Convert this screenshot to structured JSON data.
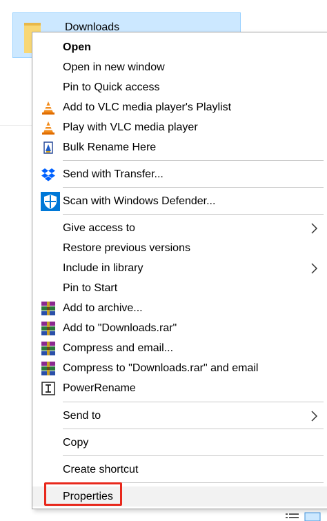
{
  "folder": {
    "label": "Downloads"
  },
  "menu": {
    "items": [
      {
        "label": "Open",
        "bold": true,
        "icon": ""
      },
      {
        "label": "Open in new window",
        "icon": ""
      },
      {
        "label": "Pin to Quick access",
        "icon": ""
      },
      {
        "label": "Add to VLC media player's Playlist",
        "icon": "vlc-cone-icon"
      },
      {
        "label": "Play with VLC media player",
        "icon": "vlc-cone-icon"
      },
      {
        "label": "Bulk Rename Here",
        "icon": "bulk-rename-icon"
      },
      {
        "label": "Send with Transfer...",
        "icon": "dropbox-icon"
      },
      {
        "label": "Scan with Windows Defender...",
        "icon": "defender-shield-icon"
      },
      {
        "label": "Give access to",
        "icon": "",
        "submenu": true
      },
      {
        "label": "Restore previous versions",
        "icon": ""
      },
      {
        "label": "Include in library",
        "icon": "",
        "submenu": true
      },
      {
        "label": "Pin to Start",
        "icon": ""
      },
      {
        "label": "Add to archive...",
        "icon": "winrar-icon"
      },
      {
        "label": "Add to \"Downloads.rar\"",
        "icon": "winrar-icon"
      },
      {
        "label": "Compress and email...",
        "icon": "winrar-icon"
      },
      {
        "label": "Compress to \"Downloads.rar\" and email",
        "icon": "winrar-icon"
      },
      {
        "label": "PowerRename",
        "icon": "powerrename-icon"
      },
      {
        "label": "Send to",
        "icon": "",
        "submenu": true
      },
      {
        "label": "Copy",
        "icon": ""
      },
      {
        "label": "Create shortcut",
        "icon": ""
      },
      {
        "label": "Properties",
        "icon": "",
        "highlighted": true
      }
    ]
  },
  "colors": {
    "selection_bg": "#cce8ff",
    "highlight_border": "#e8281c",
    "vlc_orange": "#f28c1c",
    "dropbox_blue": "#0061ff",
    "defender_blue": "#0078d7"
  }
}
